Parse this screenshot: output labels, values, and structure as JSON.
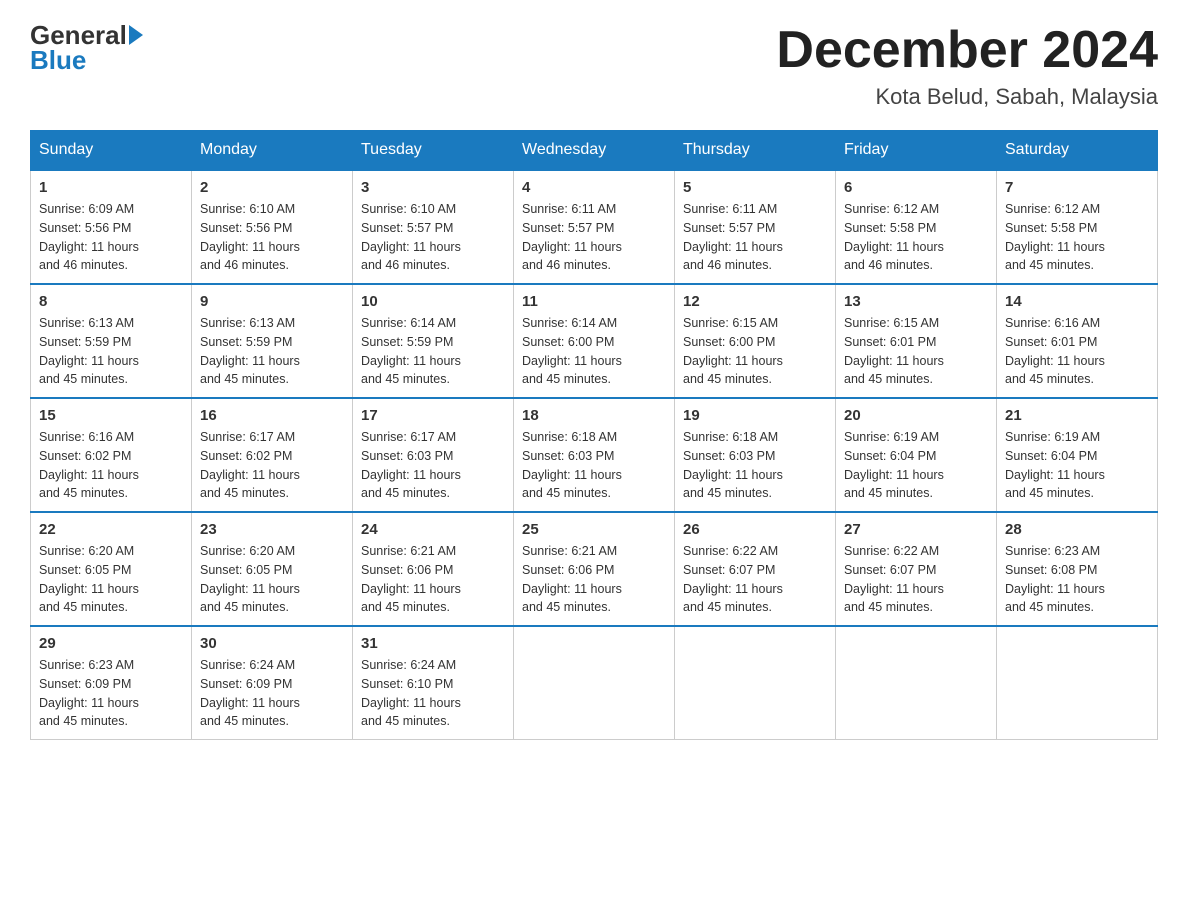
{
  "header": {
    "logo_general": "General",
    "logo_blue": "Blue",
    "month_title": "December 2024",
    "location": "Kota Belud, Sabah, Malaysia"
  },
  "days_of_week": [
    "Sunday",
    "Monday",
    "Tuesday",
    "Wednesday",
    "Thursday",
    "Friday",
    "Saturday"
  ],
  "weeks": [
    [
      {
        "day": "1",
        "sunrise": "6:09 AM",
        "sunset": "5:56 PM",
        "daylight": "11 hours and 46 minutes."
      },
      {
        "day": "2",
        "sunrise": "6:10 AM",
        "sunset": "5:56 PM",
        "daylight": "11 hours and 46 minutes."
      },
      {
        "day": "3",
        "sunrise": "6:10 AM",
        "sunset": "5:57 PM",
        "daylight": "11 hours and 46 minutes."
      },
      {
        "day": "4",
        "sunrise": "6:11 AM",
        "sunset": "5:57 PM",
        "daylight": "11 hours and 46 minutes."
      },
      {
        "day": "5",
        "sunrise": "6:11 AM",
        "sunset": "5:57 PM",
        "daylight": "11 hours and 46 minutes."
      },
      {
        "day": "6",
        "sunrise": "6:12 AM",
        "sunset": "5:58 PM",
        "daylight": "11 hours and 46 minutes."
      },
      {
        "day": "7",
        "sunrise": "6:12 AM",
        "sunset": "5:58 PM",
        "daylight": "11 hours and 45 minutes."
      }
    ],
    [
      {
        "day": "8",
        "sunrise": "6:13 AM",
        "sunset": "5:59 PM",
        "daylight": "11 hours and 45 minutes."
      },
      {
        "day": "9",
        "sunrise": "6:13 AM",
        "sunset": "5:59 PM",
        "daylight": "11 hours and 45 minutes."
      },
      {
        "day": "10",
        "sunrise": "6:14 AM",
        "sunset": "5:59 PM",
        "daylight": "11 hours and 45 minutes."
      },
      {
        "day": "11",
        "sunrise": "6:14 AM",
        "sunset": "6:00 PM",
        "daylight": "11 hours and 45 minutes."
      },
      {
        "day": "12",
        "sunrise": "6:15 AM",
        "sunset": "6:00 PM",
        "daylight": "11 hours and 45 minutes."
      },
      {
        "day": "13",
        "sunrise": "6:15 AM",
        "sunset": "6:01 PM",
        "daylight": "11 hours and 45 minutes."
      },
      {
        "day": "14",
        "sunrise": "6:16 AM",
        "sunset": "6:01 PM",
        "daylight": "11 hours and 45 minutes."
      }
    ],
    [
      {
        "day": "15",
        "sunrise": "6:16 AM",
        "sunset": "6:02 PM",
        "daylight": "11 hours and 45 minutes."
      },
      {
        "day": "16",
        "sunrise": "6:17 AM",
        "sunset": "6:02 PM",
        "daylight": "11 hours and 45 minutes."
      },
      {
        "day": "17",
        "sunrise": "6:17 AM",
        "sunset": "6:03 PM",
        "daylight": "11 hours and 45 minutes."
      },
      {
        "day": "18",
        "sunrise": "6:18 AM",
        "sunset": "6:03 PM",
        "daylight": "11 hours and 45 minutes."
      },
      {
        "day": "19",
        "sunrise": "6:18 AM",
        "sunset": "6:03 PM",
        "daylight": "11 hours and 45 minutes."
      },
      {
        "day": "20",
        "sunrise": "6:19 AM",
        "sunset": "6:04 PM",
        "daylight": "11 hours and 45 minutes."
      },
      {
        "day": "21",
        "sunrise": "6:19 AM",
        "sunset": "6:04 PM",
        "daylight": "11 hours and 45 minutes."
      }
    ],
    [
      {
        "day": "22",
        "sunrise": "6:20 AM",
        "sunset": "6:05 PM",
        "daylight": "11 hours and 45 minutes."
      },
      {
        "day": "23",
        "sunrise": "6:20 AM",
        "sunset": "6:05 PM",
        "daylight": "11 hours and 45 minutes."
      },
      {
        "day": "24",
        "sunrise": "6:21 AM",
        "sunset": "6:06 PM",
        "daylight": "11 hours and 45 minutes."
      },
      {
        "day": "25",
        "sunrise": "6:21 AM",
        "sunset": "6:06 PM",
        "daylight": "11 hours and 45 minutes."
      },
      {
        "day": "26",
        "sunrise": "6:22 AM",
        "sunset": "6:07 PM",
        "daylight": "11 hours and 45 minutes."
      },
      {
        "day": "27",
        "sunrise": "6:22 AM",
        "sunset": "6:07 PM",
        "daylight": "11 hours and 45 minutes."
      },
      {
        "day": "28",
        "sunrise": "6:23 AM",
        "sunset": "6:08 PM",
        "daylight": "11 hours and 45 minutes."
      }
    ],
    [
      {
        "day": "29",
        "sunrise": "6:23 AM",
        "sunset": "6:09 PM",
        "daylight": "11 hours and 45 minutes."
      },
      {
        "day": "30",
        "sunrise": "6:24 AM",
        "sunset": "6:09 PM",
        "daylight": "11 hours and 45 minutes."
      },
      {
        "day": "31",
        "sunrise": "6:24 AM",
        "sunset": "6:10 PM",
        "daylight": "11 hours and 45 minutes."
      },
      null,
      null,
      null,
      null
    ]
  ],
  "labels": {
    "sunrise": "Sunrise: ",
    "sunset": "Sunset: ",
    "daylight": "Daylight: "
  }
}
